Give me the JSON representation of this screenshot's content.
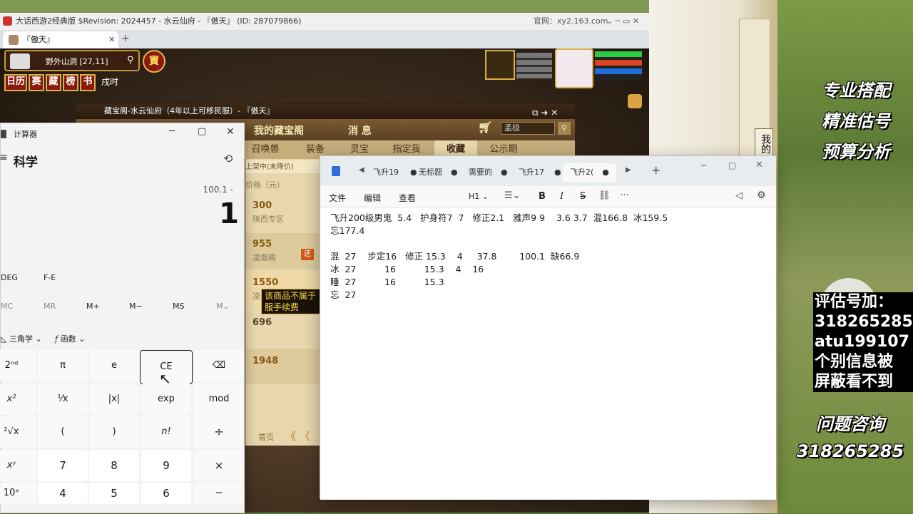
{
  "game": {
    "window_title": "大话西游2经典版 $Revision: 2024457 - 水云仙府 - 『傲天』 (ID: 287079866)",
    "official_site": "官网：xy2.163.com",
    "tab_title": "『傲天』",
    "location": "野外山洞 [27,11]",
    "vip_label": "寶",
    "hud_buttons": [
      "日历",
      "赛",
      "藏",
      "榜",
      "书"
    ],
    "time_label": "戌时"
  },
  "shop": {
    "window_title": "藏宝阁-水云仙府（4年以上可移民服）- 『傲天』",
    "header": [
      "我的藏宝阁",
      "消 息"
    ],
    "search_value": "孟极",
    "tabs": [
      "召唤兽",
      "装备",
      "灵宝",
      "指定我",
      "收藏",
      "公示期"
    ],
    "active_tab": "收藏",
    "filter_label": "上架中(未降价)",
    "filter_label2": "上架",
    "column_header": "价格（元）",
    "prices": [
      {
        "price": "300",
        "server": "陕西专区"
      },
      {
        "price": "955",
        "server": "凌烟阁"
      },
      {
        "price": "1550",
        "server": "凌"
      },
      {
        "price": "696",
        "server": ""
      },
      {
        "price": "1948",
        "server": ""
      }
    ],
    "tooltip": "该商品不属于\n服手续费",
    "pager_first": "首页"
  },
  "calculator": {
    "app_title": "计算器",
    "mode": "科学",
    "expression": "100.1 -",
    "display": "1",
    "angle_buttons": [
      "DEG",
      "F-E"
    ],
    "memory_buttons": [
      "MC",
      "MR",
      "M+",
      "M−",
      "MS",
      "M⌄"
    ],
    "function_dropdowns": [
      "三角学",
      "函数"
    ],
    "rows": [
      [
        "2ⁿᵈ",
        "π",
        "e",
        "CE",
        "⌫"
      ],
      [
        "x²",
        "¹⁄x",
        "|x|",
        "exp",
        "mod"
      ],
      [
        "²√x",
        "(",
        ")",
        "n!",
        "÷"
      ],
      [
        "xʸ",
        "7",
        "8",
        "9",
        "×"
      ],
      [
        "10ˣ",
        "4",
        "5",
        "6",
        "−"
      ]
    ]
  },
  "notepad": {
    "tabs": [
      "飞升19",
      "无标题",
      "需要的",
      "飞升17",
      "飞升2("
    ],
    "active_tab": "飞升2(",
    "menu": [
      "文件",
      "编辑",
      "查看"
    ],
    "heading_select": "H1",
    "content_lines": [
      "飞升200级男鬼  5.4   护身符7  7   修正2.1   雅声9 9    3.6 3.7  混166.8  冰159.5",
      "忘177.4",
      "",
      "混  27    步定16   修正 15.3    4     37.8        100.1  缺66.9",
      "冰  27          16          15.3    4    16",
      "睡  27          16          15.3",
      "忘  27"
    ]
  },
  "promo": {
    "slogans": [
      "专业搭配",
      "精准估号",
      "预算分析"
    ],
    "contact_lines": [
      "评估号加：",
      "318265285",
      "atu199107",
      "个别信息被",
      "屏蔽看不到"
    ],
    "consult_title": "问题咨询",
    "consult_number": "318265285"
  },
  "side_panel": {
    "vertical_text": "我的"
  },
  "colors": {
    "accent_gold": "#c59a3a",
    "shop_price": "#8a5a14",
    "calc_focus": "#1a1a1a"
  }
}
